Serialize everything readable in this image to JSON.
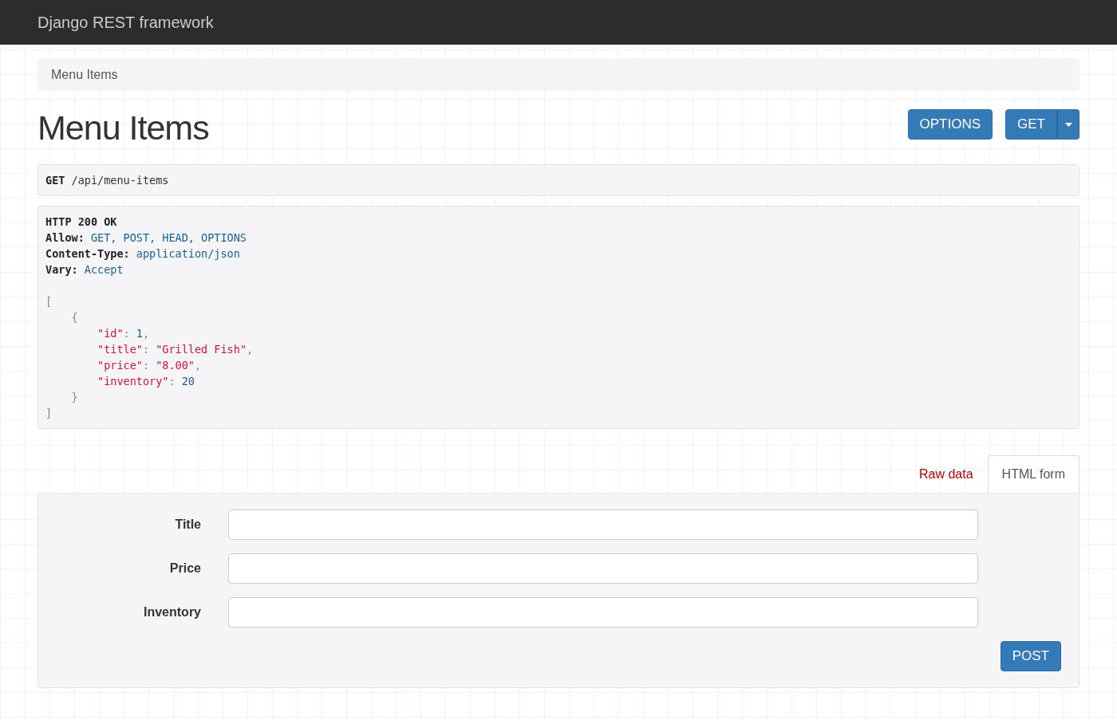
{
  "navbar": {
    "brand": "Django REST framework"
  },
  "breadcrumb": [
    "Menu Items"
  ],
  "page": {
    "title": "Menu Items",
    "actions": [
      {
        "label": "OPTIONS",
        "kind": "plain"
      },
      {
        "label": "GET",
        "kind": "split"
      }
    ]
  },
  "request": {
    "method": "GET",
    "path": "/api/menu-items"
  },
  "response": {
    "status": "HTTP 200 OK",
    "headers": [
      {
        "name": "Allow:",
        "value": "GET, POST, HEAD, OPTIONS"
      },
      {
        "name": "Content-Type:",
        "value": "application/json"
      },
      {
        "name": "Vary:",
        "value": "Accept"
      }
    ],
    "body": {
      "open": "[",
      "close": "]",
      "items": [
        {
          "open": "{",
          "close": "}",
          "fields": [
            {
              "key": "\"id\"",
              "sep": ":",
              "value": "1",
              "kind": "number",
              "trail": ","
            },
            {
              "key": "\"title\"",
              "sep": ":",
              "value": "\"Grilled Fish\"",
              "kind": "string",
              "trail": ","
            },
            {
              "key": "\"price\"",
              "sep": ":",
              "value": "\"8.00\"",
              "kind": "string",
              "trail": ","
            },
            {
              "key": "\"inventory\"",
              "sep": ":",
              "value": "20",
              "kind": "number"
            }
          ]
        }
      ]
    }
  },
  "form_tabs": [
    {
      "label": "Raw data",
      "selected": false
    },
    {
      "label": "HTML form",
      "selected": true
    }
  ],
  "form": {
    "fields": [
      {
        "label": "Title"
      },
      {
        "label": "Price"
      },
      {
        "label": "Inventory"
      }
    ],
    "submit": "POST"
  }
}
